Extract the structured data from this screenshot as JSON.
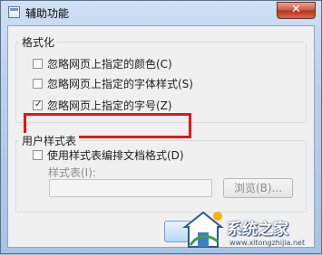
{
  "window": {
    "title": "辅助功能",
    "close_label": "✕"
  },
  "format_group": {
    "label": "格式化",
    "options": [
      {
        "label": "忽略网页上指定的颜色(C)",
        "checked": false
      },
      {
        "label": "忽略网页上指定的字体样式(S)",
        "checked": false
      },
      {
        "label": "忽略网页上指定的字号(Z)",
        "checked": true
      }
    ]
  },
  "user_style_group": {
    "label": "用户样式表",
    "use_stylesheet_label": "使用样式表编排文档格式(D)",
    "use_stylesheet_checked": false,
    "stylesheet_field_label": "样式表(I):",
    "stylesheet_value": "",
    "browse_label": "浏览(B)..."
  },
  "watermark": {
    "text": "系统之家",
    "url": "www.xitongzhijia.net"
  },
  "colors": {
    "highlight": "#e8131b",
    "accent": "#1c3e6e"
  },
  "icons": {
    "checkbox_check": "✓"
  }
}
